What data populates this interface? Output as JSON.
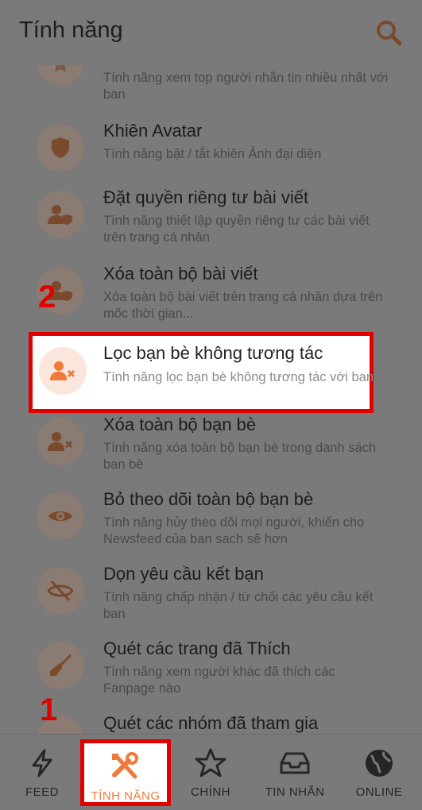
{
  "header": {
    "title": "Tính năng"
  },
  "features": [
    {
      "name": "",
      "desc": "Tính năng xem top người nhắn tin nhiều nhất với ban",
      "icon": "award-icon"
    },
    {
      "name": "Khiên Avatar",
      "desc": "Tính năng bật / tắt khiên Ảnh đại diện",
      "icon": "shield-icon"
    },
    {
      "name": "Đặt quyền riêng tư bài viết",
      "desc": "Tính năng thiết lập quyền riêng tư các bài viết trên trang cá nhân",
      "icon": "user-shield-icon"
    },
    {
      "name": "Xóa toàn bộ bài viết",
      "desc": "Xóa toàn bộ bài viết trên trang cá nhân dựa trên mốc thời gian...",
      "icon": "user-shield-icon"
    },
    {
      "name": "Lọc bạn bè không tương tác",
      "desc": "Tính năng lọc bạn bè không tương tác với ban",
      "icon": "user-remove-icon"
    },
    {
      "name": "Xóa toàn bộ bạn bè",
      "desc": "Tính năng xóa toàn bộ bạn bè trong danh sách ban bè",
      "icon": "user-remove-icon"
    },
    {
      "name": "Bỏ theo dõi toàn bộ bạn bè",
      "desc": "Tính năng hủy theo dõi mọi người, khiến cho Newsfeed của ban sach sẽ hơn",
      "icon": "eye-icon"
    },
    {
      "name": "Dọn yêu cầu kết bạn",
      "desc": "Tính năng chấp nhận / từ chối các yêu cầu kết ban",
      "icon": "eye-slash-icon"
    },
    {
      "name": "Quét các trang đã Thích",
      "desc": "Tính năng xem người khác đã thích các Fanpage nào",
      "icon": "broom-icon"
    },
    {
      "name": "Quét các nhóm đã tham gia",
      "desc": "",
      "icon": "group-icon"
    }
  ],
  "annotations": {
    "step1": "1",
    "step2": "2"
  },
  "nav": [
    {
      "label": "FEED",
      "icon": "bolt-icon"
    },
    {
      "label": "TÍNH NĂNG",
      "icon": "tools-icon"
    },
    {
      "label": "CHÍNH",
      "icon": "star-icon"
    },
    {
      "label": "TIN NHẮN",
      "icon": "inbox-icon"
    },
    {
      "label": "ONLINE",
      "icon": "globe-icon"
    }
  ],
  "colors": {
    "accent": "#f07a3a",
    "highlight_border": "#e00000",
    "overlay": "#7a7a7a"
  }
}
